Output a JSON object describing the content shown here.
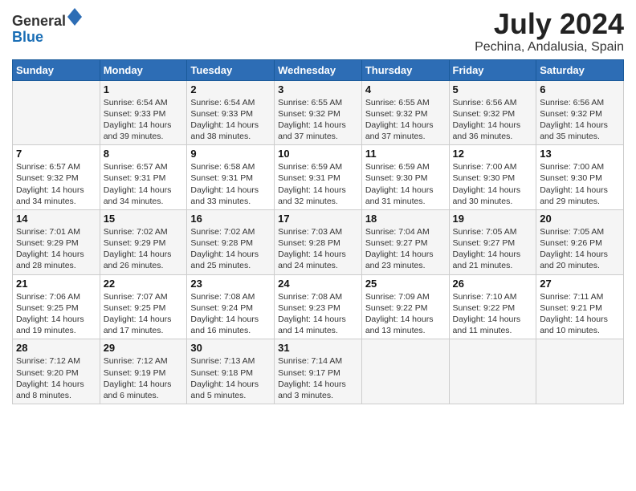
{
  "header": {
    "logo_general": "General",
    "logo_blue": "Blue",
    "month": "July 2024",
    "location": "Pechina, Andalusia, Spain"
  },
  "weekdays": [
    "Sunday",
    "Monday",
    "Tuesday",
    "Wednesday",
    "Thursday",
    "Friday",
    "Saturday"
  ],
  "weeks": [
    [
      {
        "date": "",
        "lines": []
      },
      {
        "date": "1",
        "lines": [
          "Sunrise: 6:54 AM",
          "Sunset: 9:33 PM",
          "Daylight: 14 hours",
          "and 39 minutes."
        ]
      },
      {
        "date": "2",
        "lines": [
          "Sunrise: 6:54 AM",
          "Sunset: 9:33 PM",
          "Daylight: 14 hours",
          "and 38 minutes."
        ]
      },
      {
        "date": "3",
        "lines": [
          "Sunrise: 6:55 AM",
          "Sunset: 9:32 PM",
          "Daylight: 14 hours",
          "and 37 minutes."
        ]
      },
      {
        "date": "4",
        "lines": [
          "Sunrise: 6:55 AM",
          "Sunset: 9:32 PM",
          "Daylight: 14 hours",
          "and 37 minutes."
        ]
      },
      {
        "date": "5",
        "lines": [
          "Sunrise: 6:56 AM",
          "Sunset: 9:32 PM",
          "Daylight: 14 hours",
          "and 36 minutes."
        ]
      },
      {
        "date": "6",
        "lines": [
          "Sunrise: 6:56 AM",
          "Sunset: 9:32 PM",
          "Daylight: 14 hours",
          "and 35 minutes."
        ]
      }
    ],
    [
      {
        "date": "7",
        "lines": [
          "Sunrise: 6:57 AM",
          "Sunset: 9:32 PM",
          "Daylight: 14 hours",
          "and 34 minutes."
        ]
      },
      {
        "date": "8",
        "lines": [
          "Sunrise: 6:57 AM",
          "Sunset: 9:31 PM",
          "Daylight: 14 hours",
          "and 34 minutes."
        ]
      },
      {
        "date": "9",
        "lines": [
          "Sunrise: 6:58 AM",
          "Sunset: 9:31 PM",
          "Daylight: 14 hours",
          "and 33 minutes."
        ]
      },
      {
        "date": "10",
        "lines": [
          "Sunrise: 6:59 AM",
          "Sunset: 9:31 PM",
          "Daylight: 14 hours",
          "and 32 minutes."
        ]
      },
      {
        "date": "11",
        "lines": [
          "Sunrise: 6:59 AM",
          "Sunset: 9:30 PM",
          "Daylight: 14 hours",
          "and 31 minutes."
        ]
      },
      {
        "date": "12",
        "lines": [
          "Sunrise: 7:00 AM",
          "Sunset: 9:30 PM",
          "Daylight: 14 hours",
          "and 30 minutes."
        ]
      },
      {
        "date": "13",
        "lines": [
          "Sunrise: 7:00 AM",
          "Sunset: 9:30 PM",
          "Daylight: 14 hours",
          "and 29 minutes."
        ]
      }
    ],
    [
      {
        "date": "14",
        "lines": [
          "Sunrise: 7:01 AM",
          "Sunset: 9:29 PM",
          "Daylight: 14 hours",
          "and 28 minutes."
        ]
      },
      {
        "date": "15",
        "lines": [
          "Sunrise: 7:02 AM",
          "Sunset: 9:29 PM",
          "Daylight: 14 hours",
          "and 26 minutes."
        ]
      },
      {
        "date": "16",
        "lines": [
          "Sunrise: 7:02 AM",
          "Sunset: 9:28 PM",
          "Daylight: 14 hours",
          "and 25 minutes."
        ]
      },
      {
        "date": "17",
        "lines": [
          "Sunrise: 7:03 AM",
          "Sunset: 9:28 PM",
          "Daylight: 14 hours",
          "and 24 minutes."
        ]
      },
      {
        "date": "18",
        "lines": [
          "Sunrise: 7:04 AM",
          "Sunset: 9:27 PM",
          "Daylight: 14 hours",
          "and 23 minutes."
        ]
      },
      {
        "date": "19",
        "lines": [
          "Sunrise: 7:05 AM",
          "Sunset: 9:27 PM",
          "Daylight: 14 hours",
          "and 21 minutes."
        ]
      },
      {
        "date": "20",
        "lines": [
          "Sunrise: 7:05 AM",
          "Sunset: 9:26 PM",
          "Daylight: 14 hours",
          "and 20 minutes."
        ]
      }
    ],
    [
      {
        "date": "21",
        "lines": [
          "Sunrise: 7:06 AM",
          "Sunset: 9:25 PM",
          "Daylight: 14 hours",
          "and 19 minutes."
        ]
      },
      {
        "date": "22",
        "lines": [
          "Sunrise: 7:07 AM",
          "Sunset: 9:25 PM",
          "Daylight: 14 hours",
          "and 17 minutes."
        ]
      },
      {
        "date": "23",
        "lines": [
          "Sunrise: 7:08 AM",
          "Sunset: 9:24 PM",
          "Daylight: 14 hours",
          "and 16 minutes."
        ]
      },
      {
        "date": "24",
        "lines": [
          "Sunrise: 7:08 AM",
          "Sunset: 9:23 PM",
          "Daylight: 14 hours",
          "and 14 minutes."
        ]
      },
      {
        "date": "25",
        "lines": [
          "Sunrise: 7:09 AM",
          "Sunset: 9:22 PM",
          "Daylight: 14 hours",
          "and 13 minutes."
        ]
      },
      {
        "date": "26",
        "lines": [
          "Sunrise: 7:10 AM",
          "Sunset: 9:22 PM",
          "Daylight: 14 hours",
          "and 11 minutes."
        ]
      },
      {
        "date": "27",
        "lines": [
          "Sunrise: 7:11 AM",
          "Sunset: 9:21 PM",
          "Daylight: 14 hours",
          "and 10 minutes."
        ]
      }
    ],
    [
      {
        "date": "28",
        "lines": [
          "Sunrise: 7:12 AM",
          "Sunset: 9:20 PM",
          "Daylight: 14 hours",
          "and 8 minutes."
        ]
      },
      {
        "date": "29",
        "lines": [
          "Sunrise: 7:12 AM",
          "Sunset: 9:19 PM",
          "Daylight: 14 hours",
          "and 6 minutes."
        ]
      },
      {
        "date": "30",
        "lines": [
          "Sunrise: 7:13 AM",
          "Sunset: 9:18 PM",
          "Daylight: 14 hours",
          "and 5 minutes."
        ]
      },
      {
        "date": "31",
        "lines": [
          "Sunrise: 7:14 AM",
          "Sunset: 9:17 PM",
          "Daylight: 14 hours",
          "and 3 minutes."
        ]
      },
      {
        "date": "",
        "lines": []
      },
      {
        "date": "",
        "lines": []
      },
      {
        "date": "",
        "lines": []
      }
    ]
  ]
}
